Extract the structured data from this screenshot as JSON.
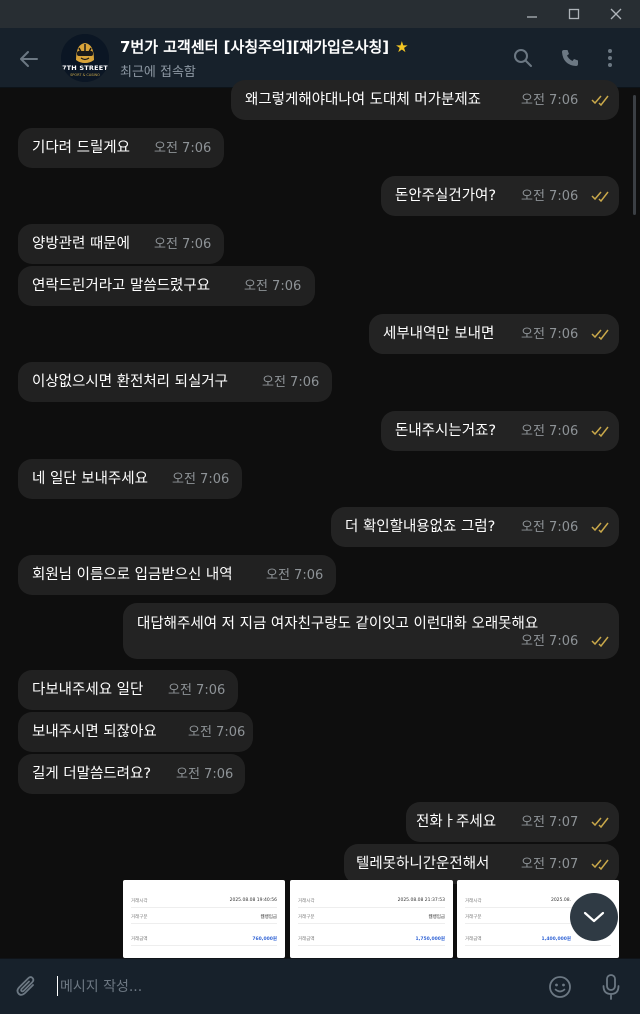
{
  "header": {
    "title": "7번가 고객센터 [사칭주의][재가입은사칭]",
    "star": "★",
    "status": "최근에 접속함",
    "avatar_text": "7TH STREET",
    "avatar_sub": "SPORT & CASINO"
  },
  "messages": [
    {
      "text": "왜그렇게해야대나여 도대체 머가분제죠",
      "time": "오전 7:06",
      "dir": "out"
    },
    {
      "text": "기다려 드릴게요",
      "time": "오전 7:06",
      "dir": "in"
    },
    {
      "text": "돈안주실건가여?",
      "time": "오전 7:06",
      "dir": "out"
    },
    {
      "text": "양방관련 때문에",
      "time": "오전 7:06",
      "dir": "in"
    },
    {
      "text": "연락드린거라고 말씀드렸구요",
      "time": "오전 7:06",
      "dir": "in"
    },
    {
      "text": "세부내역만 보내면",
      "time": "오전 7:06",
      "dir": "out"
    },
    {
      "text": "이상없으시면 환전처리 되실거구",
      "time": "오전 7:06",
      "dir": "in"
    },
    {
      "text": "돈내주시는거죠?",
      "time": "오전 7:06",
      "dir": "out"
    },
    {
      "text": "네 일단 보내주세요",
      "time": "오전 7:06",
      "dir": "in"
    },
    {
      "text": "더 확인할내용없죠 그럼?",
      "time": "오전 7:06",
      "dir": "out"
    },
    {
      "text": "회원님 이름으로 입금받으신 내역",
      "time": "오전 7:06",
      "dir": "in"
    },
    {
      "text": "대답해주세여 저 지금 여자친구랑도 같이잇고 이런대화 오래못해요",
      "time": "오전 7:06",
      "dir": "out"
    },
    {
      "text": "다보내주세요 일단",
      "time": "오전 7:06",
      "dir": "in"
    },
    {
      "text": "보내주시면 되잖아요",
      "time": "오전 7:06",
      "dir": "in"
    },
    {
      "text": "길게 더말씀드려요?",
      "time": "오전 7:06",
      "dir": "in"
    },
    {
      "text": "전화ㅏ주세요",
      "time": "오전 7:07",
      "dir": "out"
    },
    {
      "text": "텔레못하니간운전해서",
      "time": "오전 7:07",
      "dir": "out"
    }
  ],
  "receipts": [
    {
      "label1": "거래시각",
      "value1": "2025.08.08 19:40:56",
      "label2": "거래구분",
      "value2": "웹뱅입금",
      "label3": "거래금액",
      "value3": "760,000원"
    },
    {
      "label1": "거래시각",
      "value1": "2025.08.08 21:37:53",
      "label2": "거래구분",
      "value2": "웹뱅입금",
      "label3": "거래금액",
      "value3": "1,750,000원"
    },
    {
      "label1": "거래시각",
      "value1": "2025.08.",
      "label2": "거래구분",
      "value2": "",
      "label3": "거래금액",
      "value3": "1,400,000원"
    }
  ],
  "composer": {
    "placeholder": "메시지 작성..."
  },
  "colors": {
    "read_check": "#c9a84a",
    "header_bg": "#17212b",
    "bubble_bg": "#212121",
    "star": "#f3c623"
  },
  "icons": [
    "back-arrow-icon",
    "search-icon",
    "phone-icon",
    "more-vertical-icon",
    "paperclip-icon",
    "emoji-icon",
    "microphone-icon",
    "chevron-down-icon",
    "double-check-icon"
  ]
}
